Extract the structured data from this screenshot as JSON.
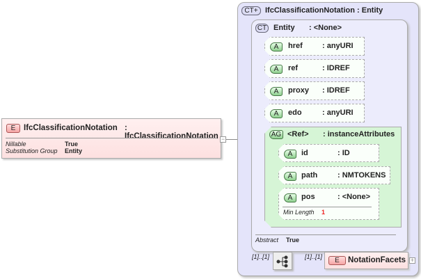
{
  "element": {
    "badge": "E",
    "name": "IfcClassificationNotation",
    "type": ": IfcClassificationNotation",
    "props": [
      {
        "label": "Nillable",
        "value": "True"
      },
      {
        "label": "Substitution Group",
        "value": "Entity"
      }
    ],
    "toggle": "−"
  },
  "complex_type": {
    "badge": "CT+",
    "title": "IfcClassificationNotation : Entity"
  },
  "base_type": {
    "badge": "CT",
    "name": "Entity",
    "type": ": <None>",
    "abstract_label": "Abstract",
    "abstract_value": "True"
  },
  "attributes": [
    {
      "badge": "A",
      "name": "href",
      "type": ": anyURI"
    },
    {
      "badge": "A",
      "name": "ref",
      "type": ": IDREF"
    },
    {
      "badge": "A",
      "name": "proxy",
      "type": ": IDREF"
    },
    {
      "badge": "A",
      "name": "edo",
      "type": ": anyURI"
    }
  ],
  "attribute_group": {
    "badge": "AG",
    "name": "<Ref>",
    "type": ": instanceAttributes",
    "attributes": [
      {
        "badge": "A",
        "name": "id",
        "type": ": ID"
      },
      {
        "badge": "A",
        "name": "path",
        "type": ": NMTOKENS"
      },
      {
        "badge": "A",
        "name": "pos",
        "type": ": <None>",
        "facet_label": "Min Length",
        "facet_value": "1"
      }
    ]
  },
  "sequence": {
    "cardinality": "[1]..[1]"
  },
  "child": {
    "cardinality": "[1]..[1]",
    "badge": "E",
    "name": "NotationFacets",
    "toggle": "+"
  }
}
